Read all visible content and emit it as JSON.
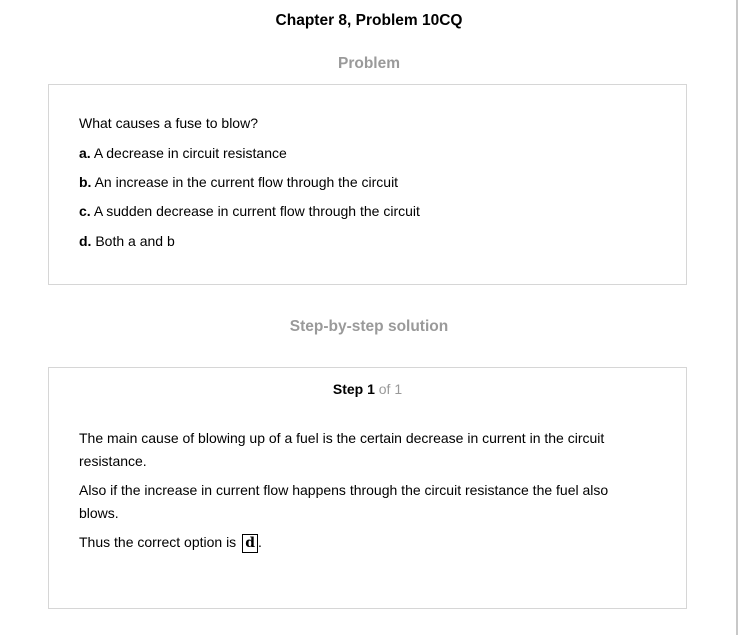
{
  "header": {
    "chapter_title": "Chapter 8, Problem 10CQ"
  },
  "problem": {
    "heading": "Problem",
    "question": "What causes a fuse to blow?",
    "options": [
      {
        "letter": "a.",
        "text": "A decrease in circuit resistance"
      },
      {
        "letter": "b.",
        "text": "An increase in the current flow through the circuit"
      },
      {
        "letter": "c.",
        "text": "A sudden decrease in current flow through the circuit"
      },
      {
        "letter": "d.",
        "text": "Both a and b"
      }
    ]
  },
  "solution": {
    "heading": "Step-by-step solution",
    "step_label": "Step 1",
    "step_of": "of 1",
    "paragraphs": [
      "The main cause of blowing up of a fuel is the certain decrease in current in the circuit resistance.",
      "Also if the increase in current flow happens through the circuit resistance the fuel also blows."
    ],
    "conclusion_text": "Thus the correct option is",
    "answer": "d",
    "answer_suffix": "."
  }
}
